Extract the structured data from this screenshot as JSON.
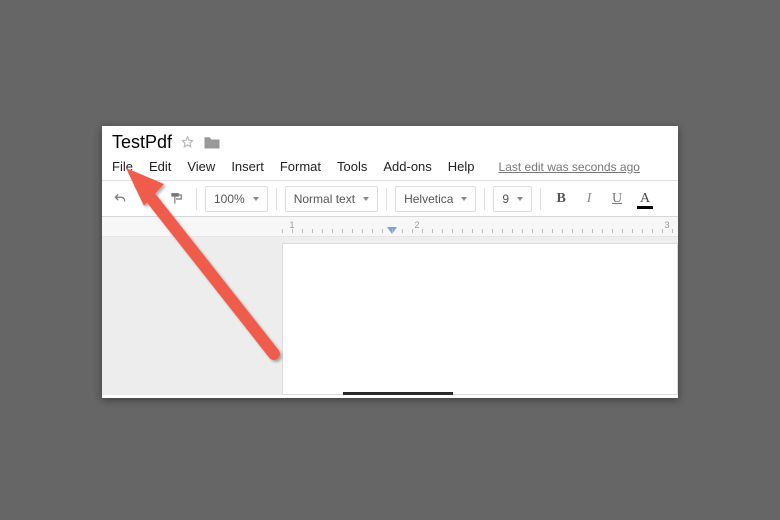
{
  "document": {
    "title": "TestPdf"
  },
  "menubar": {
    "file": "File",
    "edit": "Edit",
    "view": "View",
    "insert": "Insert",
    "format": "Format",
    "tools": "Tools",
    "addons": "Add-ons",
    "help": "Help",
    "last_edit": "Last edit was seconds ago"
  },
  "toolbar": {
    "zoom": "100%",
    "style": "Normal text",
    "font": "Helvetica",
    "font_size": "9",
    "bold": "B",
    "italic": "I",
    "underline": "U",
    "text_color": "A"
  },
  "ruler": {
    "numbers": [
      "1",
      "2",
      "3"
    ]
  }
}
